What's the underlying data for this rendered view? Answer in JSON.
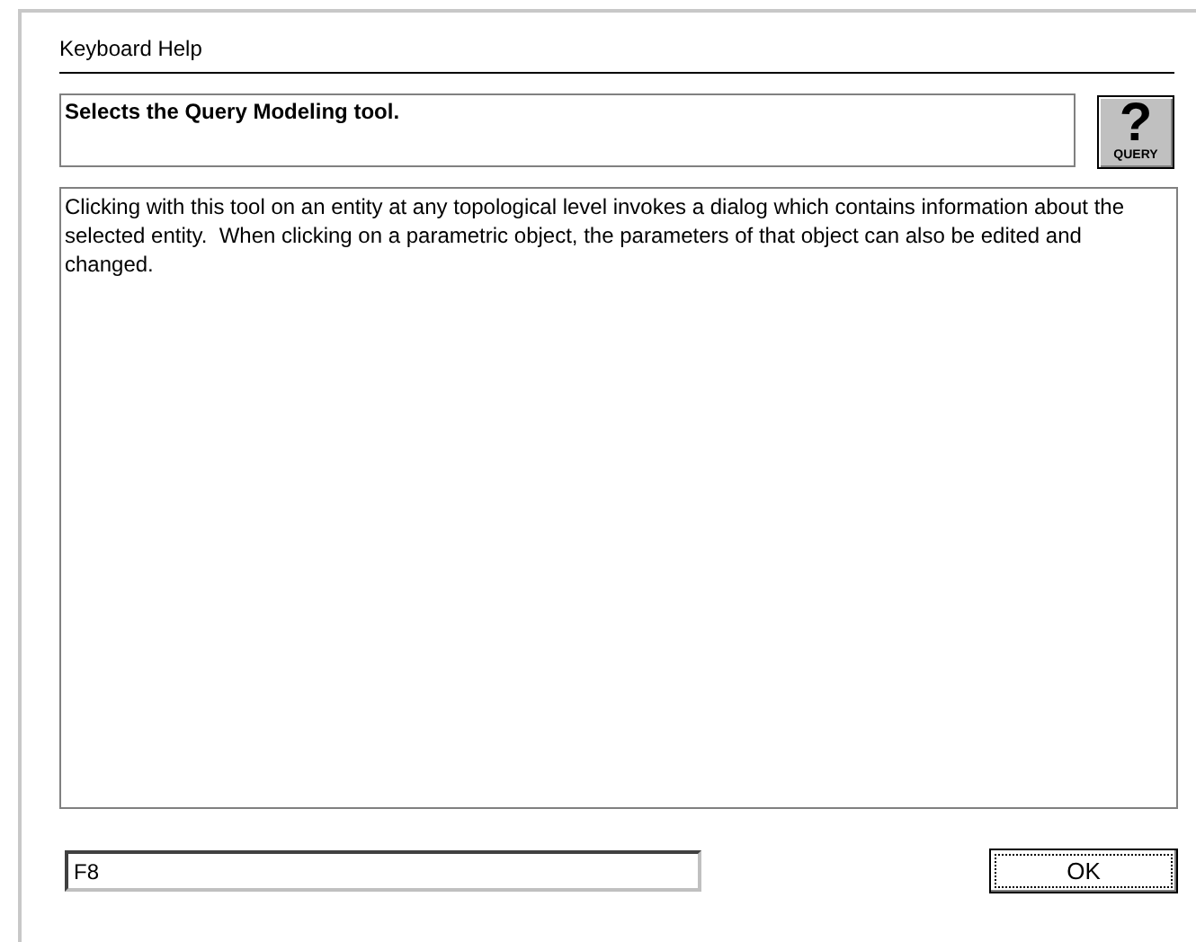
{
  "dialog": {
    "title": "Keyboard Help"
  },
  "summary": "Selects the Query Modeling tool.",
  "tool_button": {
    "symbol": "?",
    "label": "QUERY"
  },
  "description": "Clicking with this tool on an entity at any topological level invokes a dialog which contains information about the selected entity.  When clicking on a parametric object, the parameters of that object can also be edited and changed.",
  "shortcut_field": {
    "value": "F8"
  },
  "buttons": [
    {
      "label": "OK",
      "focused": true
    }
  ]
}
